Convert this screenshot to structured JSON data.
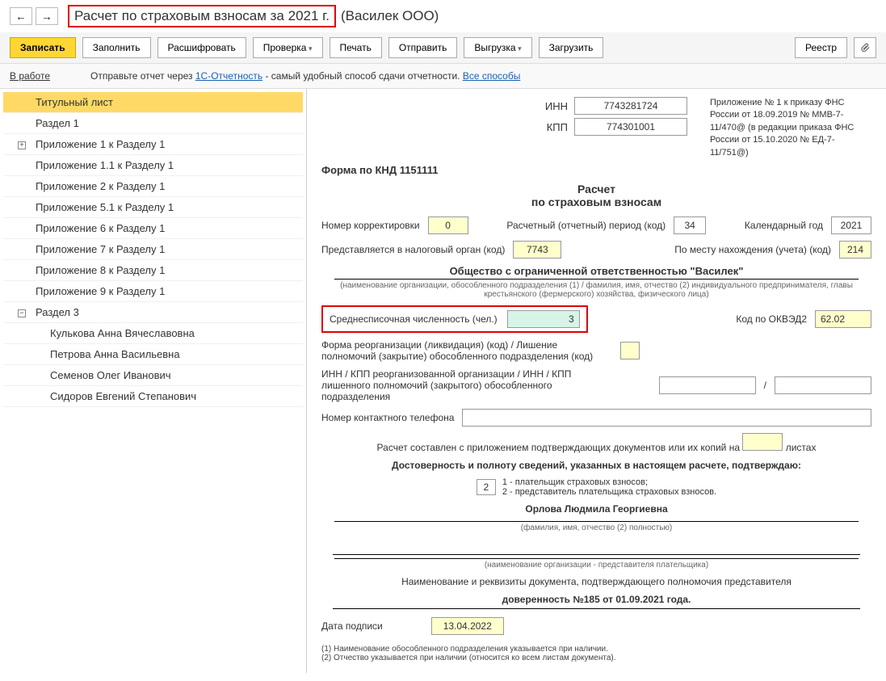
{
  "header": {
    "title_highlight": "Расчет по страховым взносам за 2021 г.",
    "title_rest": "(Василек ООО)"
  },
  "toolbar": {
    "save": "Записать",
    "fill": "Заполнить",
    "decode": "Расшифровать",
    "check": "Проверка",
    "print": "Печать",
    "send": "Отправить",
    "export": "Выгрузка",
    "import": "Загрузить",
    "registry": "Реестр"
  },
  "status": {
    "label": "В работе",
    "msg_pre": "Отправьте отчет через",
    "link1": "1С-Отчетность",
    "msg_post": "- самый удобный способ сдачи отчетности.",
    "link2": "Все способы"
  },
  "tree": [
    {
      "label": "Титульный лист",
      "level": 1,
      "selected": true
    },
    {
      "label": "Раздел 1",
      "level": 1
    },
    {
      "label": "Приложение 1 к Разделу 1",
      "level": 1,
      "expand": "plus"
    },
    {
      "label": "Приложение 1.1 к Разделу 1",
      "level": 1
    },
    {
      "label": "Приложение 2 к Разделу 1",
      "level": 1
    },
    {
      "label": "Приложение 5.1 к Разделу 1",
      "level": 1
    },
    {
      "label": "Приложение 6 к Разделу 1",
      "level": 1
    },
    {
      "label": "Приложение 7 к Разделу 1",
      "level": 1
    },
    {
      "label": "Приложение 8 к Разделу 1",
      "level": 1
    },
    {
      "label": "Приложение 9 к Разделу 1",
      "level": 1
    },
    {
      "label": "Раздел 3",
      "level": 1,
      "expand": "minus"
    },
    {
      "label": "Кулькова Анна Вячеславовна",
      "level": 2
    },
    {
      "label": "Петрова Анна Васильевна",
      "level": 2
    },
    {
      "label": "Семенов Олег Иванович",
      "level": 2
    },
    {
      "label": "Сидоров Евгений Степанович",
      "level": 2
    }
  ],
  "form": {
    "inn_label": "ИНН",
    "inn": "7743281724",
    "kpp_label": "КПП",
    "kpp": "774301001",
    "annex": "Приложение № 1 к приказу ФНС России от 18.09.2019 № ММВ-7-11/470@ (в редакции приказа ФНС России от 15.10.2020 № ЕД-7-11/751@)",
    "knd": "Форма по КНД 1151111",
    "title1": "Расчет",
    "title2": "по страховым взносам",
    "corr_label": "Номер корректировки",
    "corr": "0",
    "period_label": "Расчетный (отчетный) период (код)",
    "period": "34",
    "year_label": "Календарный год",
    "year": "2021",
    "tax_org_label": "Представляется в налоговый орган (код)",
    "tax_org": "7743",
    "loc_label": "По месту нахождения (учета) (код)",
    "loc": "214",
    "org_name": "Общество с ограниченной ответственностью \"Василек\"",
    "org_hint": "(наименование организации, обособленного подразделения (1) / фамилия, имя, отчество (2) индивидуального предпринимателя, главы крестьянского (фермерского) хозяйства, физического лица)",
    "avg_label": "Среднесписочная численность (чел.)",
    "avg": "3",
    "okved_label": "Код по ОКВЭД2",
    "okved": "62.02",
    "reorg_label": "Форма реорганизации (ликвидация) (код) / Лишение полномочий (закрытие) обособленного подразделения (код)",
    "reorg_inn_label": "ИНН / КПП реорганизованной организации / ИНН / КПП лишенного полномочий (закрытого) обособленного подразделения",
    "slash": "/",
    "phone_label": "Номер контактного телефона",
    "docs_pre": "Расчет составлен с приложением подтверждающих документов или их копий на",
    "docs_post": "листах",
    "confirm_title": "Достоверность и полноту сведений, указанных в настоящем расчете, подтверждаю:",
    "confirm_code": "2",
    "confirm_opts": "1 - плательщик страховых взносов;\n2 - представитель плательщика страховых взносов.",
    "signer": "Орлова Людмила Георгиевна",
    "signer_hint": "(фамилия, имя, отчество (2) полностью)",
    "rep_hint": "(наименование организации - представителя плательщика)",
    "doc_title": "Наименование и реквизиты документа, подтверждающего полномочия представителя",
    "doc_value": "доверенность №185 от 01.09.2021 года.",
    "sign_date_label": "Дата подписи",
    "sign_date": "13.04.2022",
    "footnote1": "(1) Наименование обособленного подразделения указывается при наличии.",
    "footnote2": "(2) Отчество указывается при наличии (относится ко всем листам документа)."
  }
}
